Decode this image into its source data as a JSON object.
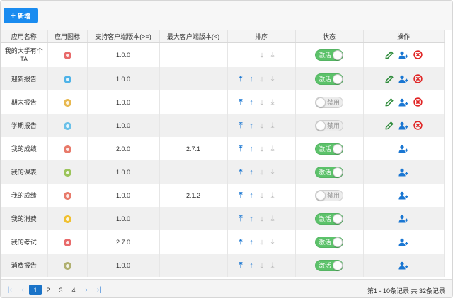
{
  "toolbar": {
    "add_label": "新增"
  },
  "columns": [
    "应用名称",
    "应用图标",
    "支持客户端版本(>=)",
    "最大客户端版本(<)",
    "排序",
    "状态",
    "操作"
  ],
  "rows": [
    {
      "name": "我的大学有个TA",
      "icon_color": "#e86a6a",
      "min_version": "1.0.0",
      "max_version": "",
      "sort_up": false,
      "status": "激活",
      "active": true,
      "editable": true
    },
    {
      "name": "迎新报告",
      "icon_color": "#4fb3e8",
      "min_version": "1.0.0",
      "max_version": "",
      "sort_up": true,
      "status": "激活",
      "active": true,
      "editable": true
    },
    {
      "name": "期末报告",
      "icon_color": "#e8b84f",
      "min_version": "1.0.0",
      "max_version": "",
      "sort_up": true,
      "status": "禁用",
      "active": false,
      "editable": true
    },
    {
      "name": "学期报告",
      "icon_color": "#6ac0e8",
      "min_version": "1.0.0",
      "max_version": "",
      "sort_up": true,
      "status": "禁用",
      "active": false,
      "editable": true
    },
    {
      "name": "我的成绩",
      "icon_color": "#e87a6a",
      "min_version": "2.0.0",
      "max_version": "2.7.1",
      "sort_up": true,
      "status": "激活",
      "active": true,
      "editable": false
    },
    {
      "name": "我的课表",
      "icon_color": "#9bc45a",
      "min_version": "1.0.0",
      "max_version": "",
      "sort_up": true,
      "status": "激活",
      "active": true,
      "editable": false
    },
    {
      "name": "我的成绩",
      "icon_color": "#e87a6a",
      "min_version": "1.0.0",
      "max_version": "2.1.2",
      "sort_up": true,
      "status": "禁用",
      "active": false,
      "editable": false
    },
    {
      "name": "我的消费",
      "icon_color": "#f0c030",
      "min_version": "1.0.0",
      "max_version": "",
      "sort_up": true,
      "status": "激活",
      "active": true,
      "editable": false
    },
    {
      "name": "我的考试",
      "icon_color": "#e86a6a",
      "min_version": "2.7.0",
      "max_version": "",
      "sort_up": true,
      "status": "激活",
      "active": true,
      "editable": false
    },
    {
      "name": "消费报告",
      "icon_color": "#b0b070",
      "min_version": "1.0.0",
      "max_version": "",
      "sort_up": true,
      "status": "激活",
      "active": true,
      "editable": false
    }
  ],
  "icons": {
    "sort_top": "arrow-to-top-icon",
    "sort_up": "arrow-up-icon",
    "sort_down": "arrow-down-icon",
    "sort_bottom": "arrow-to-bottom-icon",
    "edit": "pencil-icon",
    "assign": "add-user-icon",
    "delete": "delete-circle-icon"
  },
  "colors": {
    "primary": "#1a8cf0",
    "toggle_on": "#5cc26a",
    "action_blue": "#1976d2",
    "edit_green": "#2e8b3a",
    "delete_red": "#e02424"
  },
  "pagination": {
    "first": "|‹",
    "prev": "‹",
    "pages": [
      "1",
      "2",
      "3",
      "4"
    ],
    "current": "1",
    "next": "›",
    "last": "›|",
    "summary": "第1 - 10条记录 共 32条记录"
  }
}
